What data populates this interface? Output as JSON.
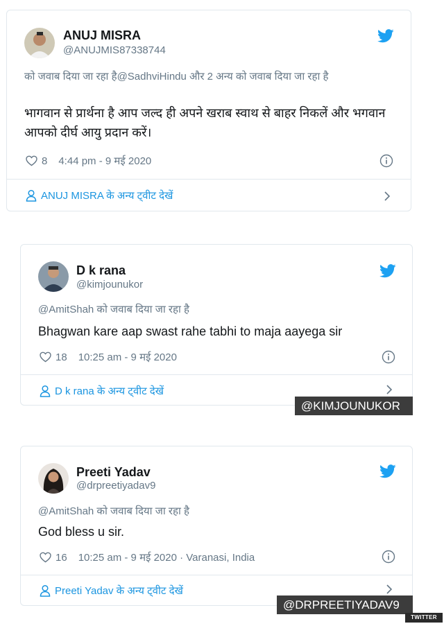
{
  "tweets": [
    {
      "name": "ANUJ MISRA",
      "handle": "@ANUJMIS87338744",
      "reply_to": "को जवाब दिया जा रहा है@SadhviHindu और 2 अन्य को जवाब दिया जा रहा है",
      "text": "भागवान से प्रार्थना है आप जल्द ही अपने खराब स्वाथ से बाहर निकलें और भगवान आपको दीर्घ आयु प्रदान करें।",
      "likes": "8",
      "timestamp": "4:44 pm - 9 मई 2020",
      "location": "",
      "footer": "ANUJ MISRA के अन्य ट्वीट देखें"
    },
    {
      "name": "D k rana",
      "handle": "@kimjounukor",
      "reply_to": "@AmitShah को जवाब दिया जा रहा है",
      "text": "Bhagwan kare aap swast rahe tabhi to maja aayega sir",
      "likes": "18",
      "timestamp": "10:25 am - 9 मई 2020",
      "location": "",
      "footer": "D k rana के अन्य ट्वीट देखें",
      "credit": "@KIMJOUNUKOR"
    },
    {
      "name": "Preeti Yadav",
      "handle": "@drpreetiyadav9",
      "reply_to": "@AmitShah को जवाब दिया जा रहा है",
      "text": "God bless u sir.",
      "likes": "16",
      "timestamp": "10:25 am - 9 मई 2020 · Varanasi, India",
      "location": "",
      "footer": "Preeti Yadav के अन्य ट्वीट देखें",
      "credit": "@DRPREETIYADAV9"
    }
  ],
  "source_label": "TWITTER",
  "colors": {
    "twitter_blue": "#1da1f2",
    "link_blue": "#1b95e0",
    "muted_gray": "#657786",
    "border": "#e1e8ed",
    "credit_bg": "#3c3c3c"
  },
  "icons": [
    "twitter-bird-icon",
    "heart-icon",
    "info-icon",
    "person-icon",
    "chevron-right-icon"
  ]
}
